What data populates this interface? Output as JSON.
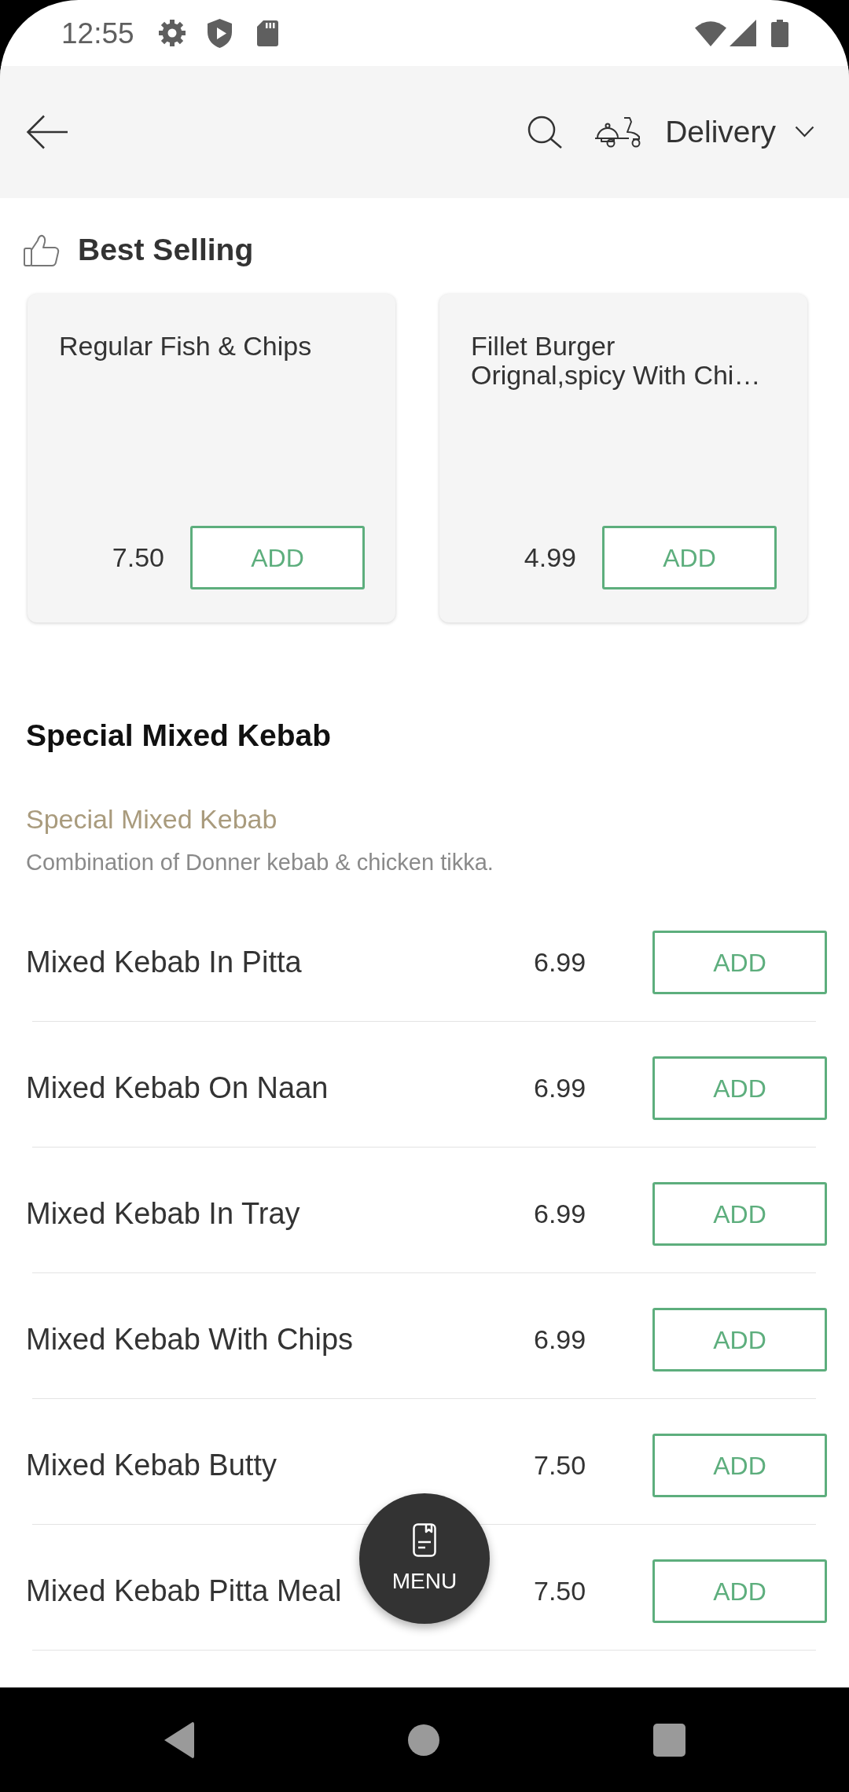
{
  "status_bar": {
    "time": "12:55"
  },
  "header": {
    "order_type": "Delivery"
  },
  "best_selling": {
    "title": "Best Selling",
    "items": [
      {
        "name": "Regular Fish & Chips",
        "price": "7.50",
        "button": "ADD"
      },
      {
        "name": "Fillet Burger Orignal,spicy With Chi…",
        "price": "4.99",
        "button": "ADD"
      }
    ]
  },
  "category": {
    "title": "Special Mixed Kebab",
    "subtitle": "Special Mixed Kebab",
    "description": "Combination of Donner kebab & chicken tikka.",
    "items": [
      {
        "name": "Mixed Kebab In Pitta",
        "price": "6.99",
        "button": "ADD"
      },
      {
        "name": "Mixed Kebab On Naan",
        "price": "6.99",
        "button": "ADD"
      },
      {
        "name": "Mixed Kebab In Tray",
        "price": "6.99",
        "button": "ADD"
      },
      {
        "name": "Mixed Kebab With Chips",
        "price": "6.99",
        "button": "ADD"
      },
      {
        "name": "Mixed Kebab Butty",
        "price": "7.50",
        "button": "ADD"
      },
      {
        "name": "Mixed Kebab Pitta Meal",
        "price": "7.50",
        "button": "ADD"
      }
    ]
  },
  "fab": {
    "label": "MENU"
  }
}
